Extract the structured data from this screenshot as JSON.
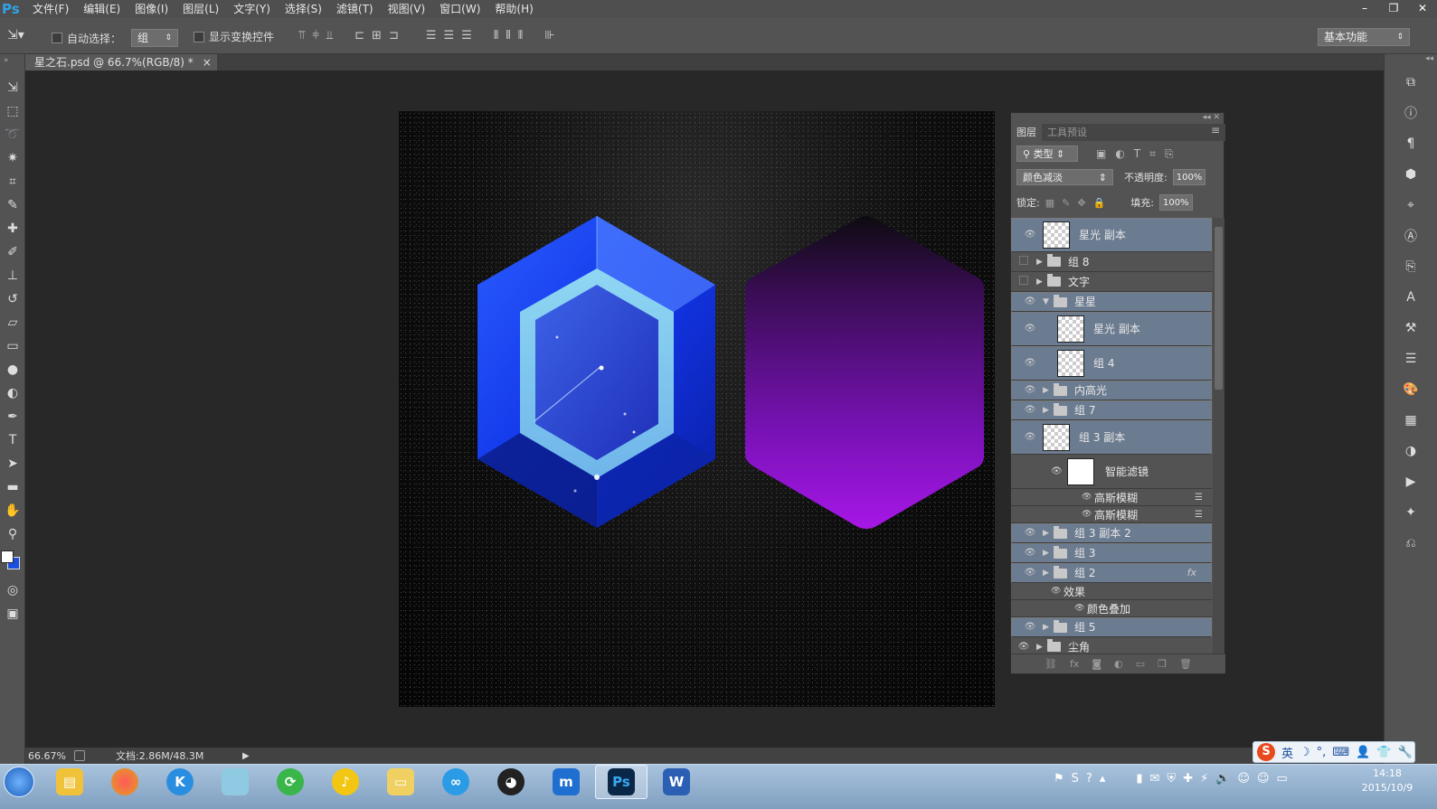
{
  "app": {
    "logo": "Ps"
  },
  "menu": [
    "文件(F)",
    "编辑(E)",
    "图像(I)",
    "图层(L)",
    "文字(Y)",
    "选择(S)",
    "滤镜(T)",
    "视图(V)",
    "窗口(W)",
    "帮助(H)"
  ],
  "window_controls": {
    "minimize": "–",
    "restore": "❐",
    "close": "✕"
  },
  "options": {
    "auto_select_label": "自动选择：",
    "auto_select_value": "组",
    "show_transform_label": "显示变换控件",
    "workspace": "基本功能"
  },
  "document_tab": {
    "title": "星之石.psd @ 66.7%(RGB/8) *",
    "close": "×"
  },
  "layers_panel": {
    "tab_layers": "图层",
    "tab_presets": "工具预设",
    "filter_kind": "类型",
    "blend_mode": "颜色减淡",
    "opacity_label": "不透明度:",
    "opacity_value": "100%",
    "lock_label": "锁定:",
    "fill_label": "填充:",
    "fill_value": "100%",
    "layers": [
      {
        "name": "星光 副本",
        "type": "pixel",
        "visible": true,
        "selected": true,
        "indent": 0
      },
      {
        "name": "组 8",
        "type": "group",
        "visible": false,
        "selected": false,
        "indent": 0
      },
      {
        "name": "文字",
        "type": "group",
        "visible": false,
        "selected": false,
        "indent": 0
      },
      {
        "name": "星星",
        "type": "group-open",
        "visible": true,
        "selected": true,
        "indent": 0
      },
      {
        "name": "星光 副本",
        "type": "pixel",
        "visible": true,
        "selected": true,
        "indent": 1
      },
      {
        "name": "组 4",
        "type": "smart",
        "visible": true,
        "selected": true,
        "indent": 1
      },
      {
        "name": "内高光",
        "type": "group",
        "visible": true,
        "selected": true,
        "indent": 0
      },
      {
        "name": "组 7",
        "type": "group",
        "visible": true,
        "selected": true,
        "indent": 0
      },
      {
        "name": "组 3 副本",
        "type": "smart",
        "visible": true,
        "selected": true,
        "indent": 0
      },
      {
        "name": "智能滤镜",
        "type": "filter-mask",
        "visible": true,
        "selected": false,
        "indent": 1
      },
      {
        "name": "高斯模糊",
        "type": "filter",
        "visible": true,
        "selected": false,
        "indent": 2
      },
      {
        "name": "高斯模糊",
        "type": "filter",
        "visible": true,
        "selected": false,
        "indent": 2
      },
      {
        "name": "组 3 副本 2",
        "type": "group",
        "visible": true,
        "selected": true,
        "indent": 0
      },
      {
        "name": "组 3",
        "type": "group",
        "visible": true,
        "selected": true,
        "indent": 0
      },
      {
        "name": "组 2",
        "type": "group",
        "visible": true,
        "selected": true,
        "indent": 0,
        "fx": "fx"
      },
      {
        "name": "效果",
        "type": "effects",
        "visible": true,
        "selected": false,
        "indent": 1
      },
      {
        "name": "颜色叠加",
        "type": "effect",
        "visible": true,
        "selected": false,
        "indent": 2
      },
      {
        "name": "组 5",
        "type": "group",
        "visible": true,
        "selected": true,
        "indent": 0
      },
      {
        "name": "尘角",
        "type": "group",
        "visible": true,
        "selected": false,
        "indent": 0
      }
    ],
    "bottom_icons": [
      "link-icon",
      "fx-icon",
      "mask-icon",
      "adjustment-icon",
      "new-group-icon",
      "new-layer-icon",
      "trash-icon"
    ],
    "fx_glyph": "fx"
  },
  "status": {
    "zoom": "66.67%",
    "doc_info": "文档:2.86M/48.3M"
  },
  "taskbar": {
    "time": "14:18",
    "date": "2015/10/9",
    "ime": "英"
  },
  "colors": {
    "menubar": "#4f4f4f",
    "panel": "#535353",
    "selected_layer": "#6b7b90",
    "gem_blue": "#1a3cff",
    "gem_purple": "#9a12d8"
  }
}
